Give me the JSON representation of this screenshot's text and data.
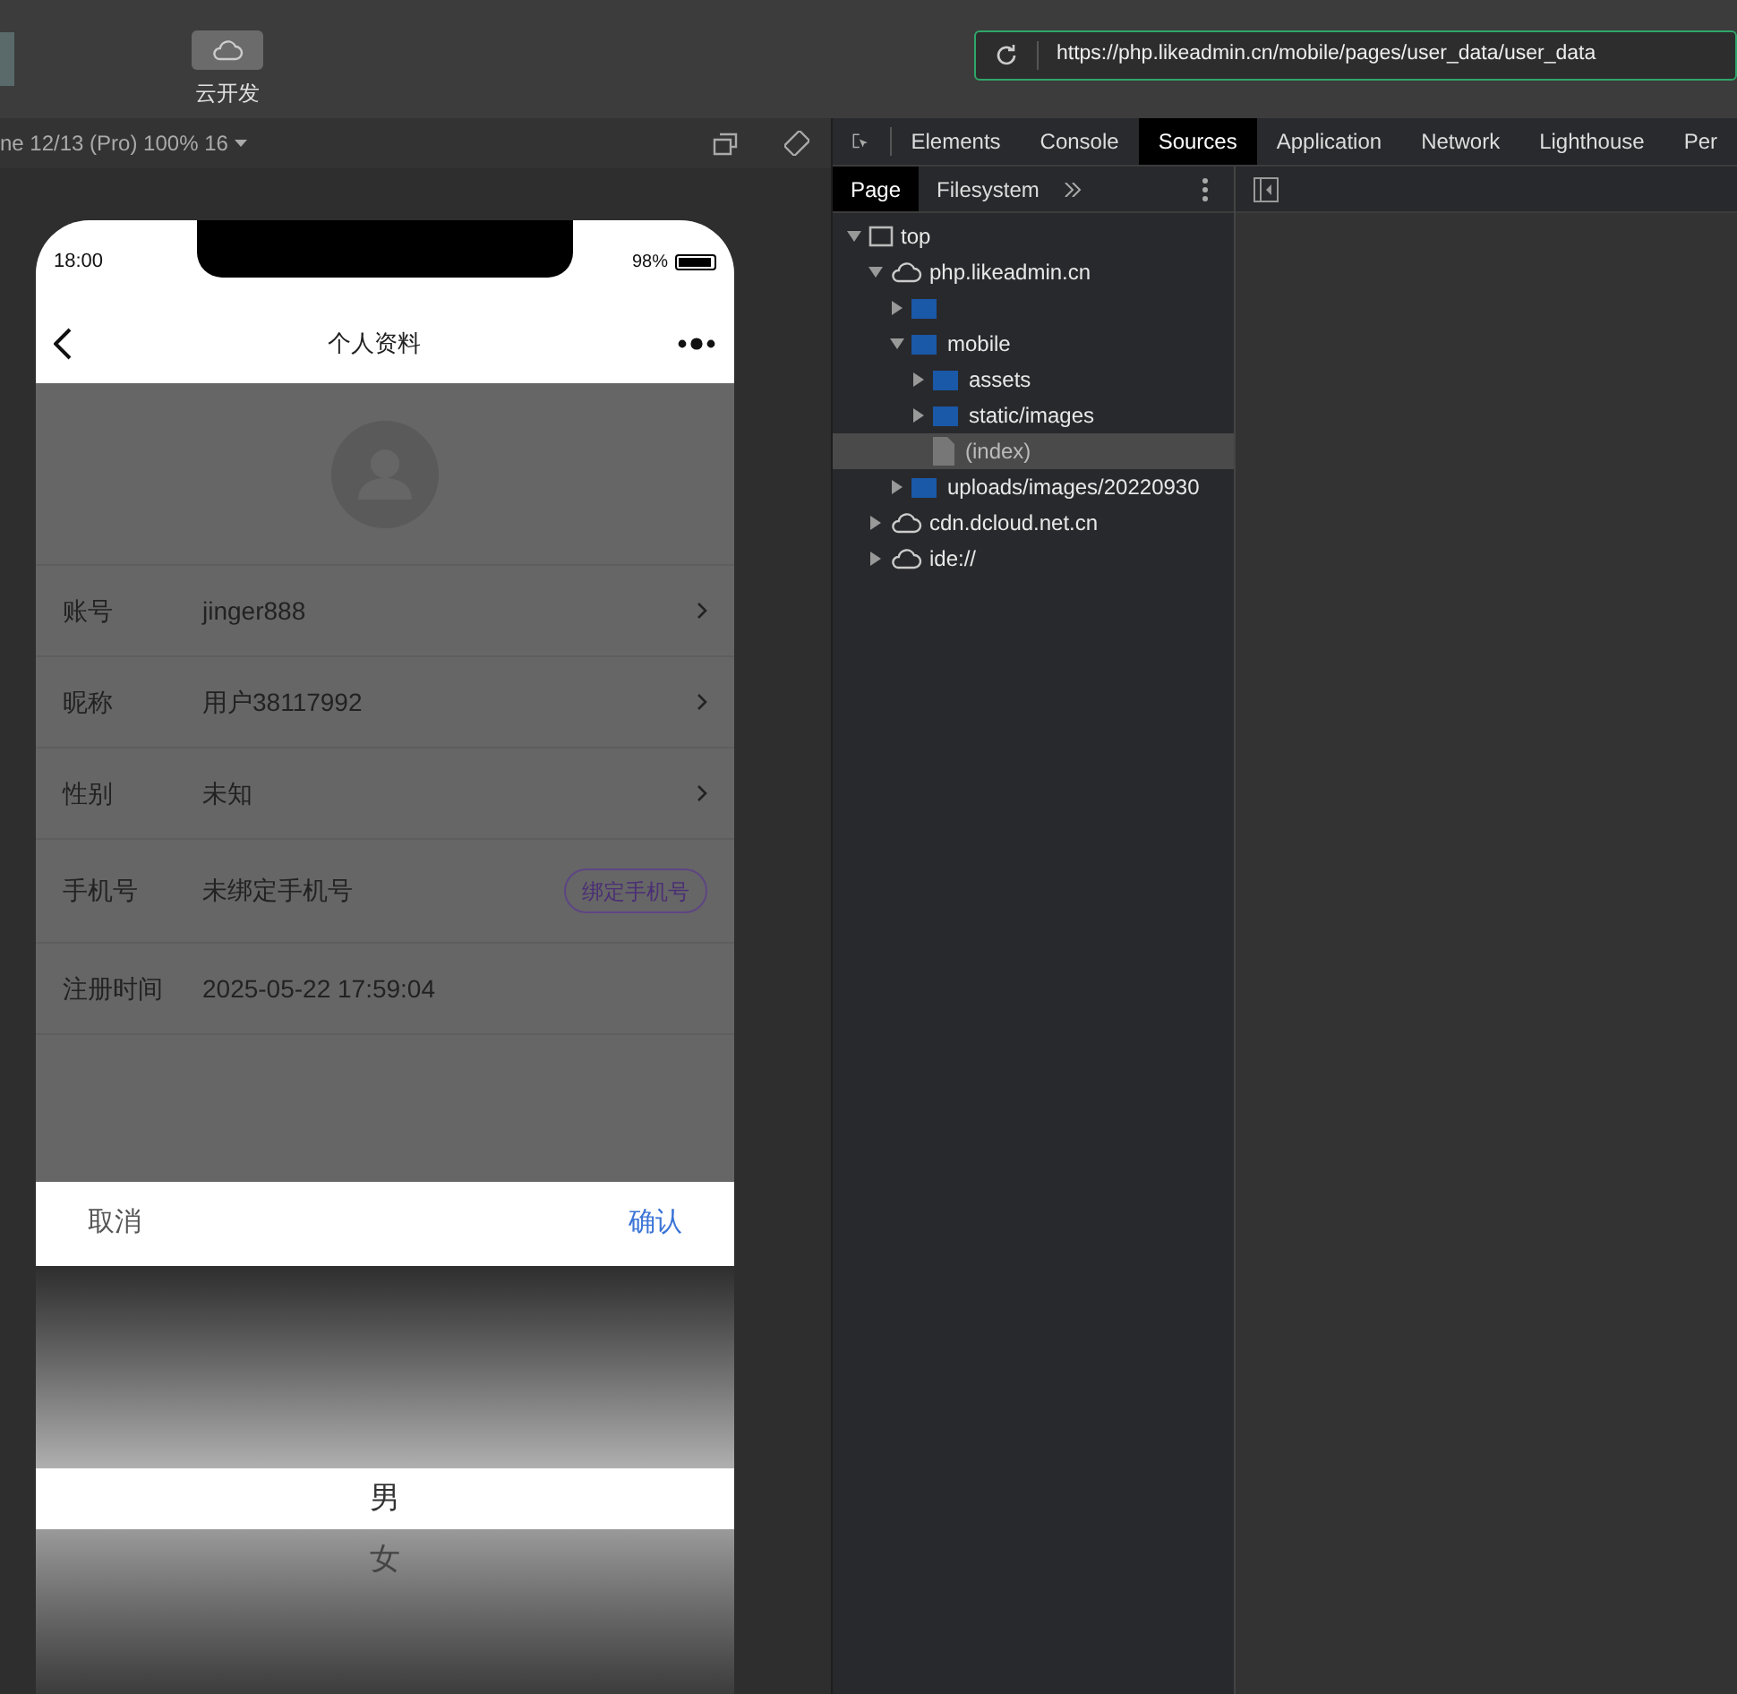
{
  "top_bar": {
    "cloud_button": {
      "label": "云开发"
    },
    "url": "https://php.likeadmin.cn/mobile/pages/user_data/user_data"
  },
  "simulator_toolbar": {
    "device": "ne 12/13 (Pro) 100% 16"
  },
  "phone": {
    "status_bar": {
      "time": "18:00",
      "battery": "98%",
      "level": 0.95
    },
    "nav_title": "个人资料",
    "rows": [
      {
        "kind": "arrow",
        "label": "账号",
        "value": "jinger888"
      },
      {
        "kind": "arrow",
        "label": "昵称",
        "value": "用户38117992"
      },
      {
        "kind": "arrow",
        "label": "性别",
        "value": "未知"
      },
      {
        "kind": "button",
        "label": "手机号",
        "value": "未绑定手机号",
        "action": "绑定手机号"
      },
      {
        "kind": "plain",
        "label": "注册时间",
        "value": "2025-05-22 17:59:04"
      }
    ],
    "picker": {
      "cancel": "取消",
      "confirm": "确认",
      "options": [
        {
          "label": "男",
          "selected": true
        },
        {
          "label": "女",
          "selected": false
        }
      ]
    }
  },
  "devtools": {
    "tabs": [
      {
        "label": "Elements",
        "selected": false
      },
      {
        "label": "Console",
        "selected": false
      },
      {
        "label": "Sources",
        "selected": true
      },
      {
        "label": "Application",
        "selected": false
      },
      {
        "label": "Network",
        "selected": false
      },
      {
        "label": "Lighthouse",
        "selected": false
      },
      {
        "label": "Per",
        "selected": false
      }
    ],
    "sub_tabs": [
      {
        "label": "Page",
        "selected": true
      },
      {
        "label": "Filesystem",
        "selected": false
      }
    ],
    "tree": [
      {
        "kind": "frame",
        "label": "top",
        "expanded": true,
        "selected": false,
        "children": [
          {
            "kind": "domain",
            "label": "php.likeadmin.cn",
            "expanded": true,
            "selected": false,
            "children": [
              {
                "kind": "folder",
                "expanded": false,
                "selected": false
              },
              {
                "kind": "folder",
                "label": "mobile",
                "expanded": true,
                "selected": false,
                "children": [
                  {
                    "kind": "folder",
                    "label": "assets",
                    "expanded": false,
                    "selected": false
                  },
                  {
                    "kind": "folder",
                    "label": "static/images",
                    "expanded": false,
                    "selected": false
                  },
                  {
                    "kind": "file",
                    "label": "(index)",
                    "selected": true
                  }
                ]
              },
              {
                "kind": "folder",
                "label": "uploads/images/20220930",
                "expanded": false,
                "selected": false
              }
            ]
          },
          {
            "kind": "domain",
            "label": "cdn.dcloud.net.cn",
            "expanded": false,
            "selected": false
          },
          {
            "kind": "domain",
            "label": "ide://",
            "expanded": false,
            "selected": false
          }
        ]
      }
    ]
  }
}
